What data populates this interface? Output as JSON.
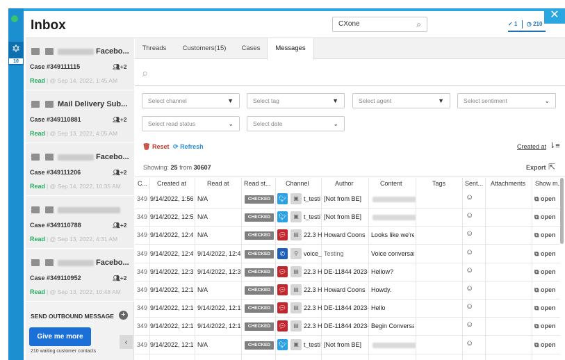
{
  "header": {
    "title": "Inbox",
    "search_value": "CXone",
    "checked_count": "1",
    "pending_count": "210"
  },
  "rail": {
    "badge": "10"
  },
  "inbox_items": [
    {
      "name_visible": "Facebo...",
      "case": "Case #349111115",
      "people": "+2",
      "status": "Read",
      "date": "@ Sep 14, 2022, 1:45 AM"
    },
    {
      "name_visible": "Mail Delivery Sub...",
      "case": "Case #349110881",
      "people": "+2",
      "status": "Read",
      "date": "@ Sep 13, 2022, 4:05 AM"
    },
    {
      "name_visible": "Facebo...",
      "case": "Case #349111206",
      "people": "+2",
      "status": "Read",
      "date": "@ Sep 14, 2022, 10:35 AM"
    },
    {
      "name_visible": "",
      "case": "Case #349110788",
      "people": "+2",
      "status": "Read",
      "date": "@ Sep 13, 2022, 4:31 AM"
    },
    {
      "name_visible": "Facebo...",
      "case": "Case #349110952",
      "people": "+2",
      "status": "Read",
      "date": "@ Sep 13, 2022, 10:48 AM"
    }
  ],
  "sidebar_footer": {
    "send_outbound": "SEND OUTBOUND MESSAGE",
    "give_me_more": "Give me more",
    "waiting": "210 waiting customer contacts"
  },
  "tabs": [
    "Threads",
    "Customers(15)",
    "Cases",
    "Messages"
  ],
  "filters": {
    "channel": "Select channel",
    "tag": "Select tag",
    "agent": "Select agent",
    "sentiment": "Select sentiment",
    "read_status": "Select read status",
    "date": "Select date"
  },
  "actions": {
    "reset": "Reset",
    "refresh": "Refresh",
    "created_at": "Created at",
    "export": "Export"
  },
  "showing": {
    "prefix": "Showing:",
    "count": "25",
    "from": "from",
    "total": "30607"
  },
  "columns": [
    "C...",
    "Created at",
    "Read at",
    "Read st...",
    "Channel",
    "Author",
    "Content",
    "Tags",
    "Sent...",
    "Attachments",
    "Show m..."
  ],
  "rows": [
    {
      "id": "349",
      "created": "9/14/2022, 1:56",
      "read": "N/A",
      "status": "CHECKED",
      "channel": "twitter",
      "channel_text": "t_testi",
      "author": "[Not from BE]",
      "content": "",
      "open": "open"
    },
    {
      "id": "349",
      "created": "9/14/2022, 12:5",
      "read": "N/A",
      "status": "CHECKED",
      "channel": "twitter",
      "channel_text": "t_testi",
      "author": "[Not from BE]",
      "content": "",
      "open": "open"
    },
    {
      "id": "349",
      "created": "9/14/2022, 12:4",
      "read": "N/A",
      "status": "CHECKED",
      "channel": "sms",
      "channel_text": "22.3 H",
      "author": "Howard Coons",
      "content": "Looks like we're",
      "open": "open"
    },
    {
      "id": "349",
      "created": "9/14/2022, 12:4",
      "read": "9/14/2022, 12:4",
      "status": "CHECKED",
      "channel": "phone",
      "channel_text": "voice_",
      "author": "Testing",
      "content": "Voice conversat",
      "open": "open"
    },
    {
      "id": "349",
      "created": "9/14/2022, 12:3",
      "read": "9/14/2022, 12:3",
      "status": "CHECKED",
      "channel": "sms",
      "channel_text": "22.3 H",
      "author": "DE-11844 2023-",
      "content": "Hellow?",
      "open": "open"
    },
    {
      "id": "349",
      "created": "9/14/2022, 12:1",
      "read": "N/A",
      "status": "CHECKED",
      "channel": "sms",
      "channel_text": "22.3 H",
      "author": "Howard Coons",
      "content": "Howdy.",
      "open": "open"
    },
    {
      "id": "349",
      "created": "9/14/2022, 12:1",
      "read": "9/14/2022, 12:1",
      "status": "CHECKED",
      "channel": "sms",
      "channel_text": "22.3 H",
      "author": "DE-11844 2023-",
      "content": "Hello",
      "open": "open"
    },
    {
      "id": "349",
      "created": "9/14/2022, 12:1",
      "read": "9/14/2022, 12:1",
      "status": "CHECKED",
      "channel": "sms",
      "channel_text": "22.3 H",
      "author": "DE-11844 2023-",
      "content": "Begin Conversa",
      "open": "open"
    },
    {
      "id": "349",
      "created": "9/14/2022, 12:1",
      "read": "N/A",
      "status": "CHECKED",
      "channel": "twitter",
      "channel_text": "t_testi",
      "author": "[Not from BE]",
      "content": "",
      "open": "open"
    }
  ],
  "colors": {
    "accent": "#2aa7e0",
    "brand_blue": "#1b70d8",
    "read_green": "#27ae60",
    "twitter": "#2aa1e1",
    "sms": "#c0282e",
    "phone": "#1e5fb8"
  }
}
